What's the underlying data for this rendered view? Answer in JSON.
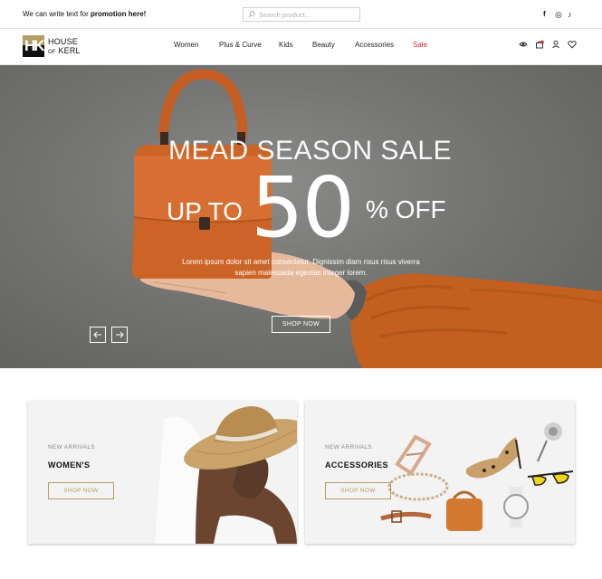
{
  "promo": {
    "prefix": "We can write text for ",
    "bold": "promotion here!"
  },
  "search": {
    "placeholder": "Search product..."
  },
  "social": {
    "facebook": "f",
    "instagram": "◎",
    "tiktok": "♪"
  },
  "logo": {
    "mark": "HK",
    "line1": "HOUSE",
    "line2_small": "OF",
    "line2": "KERL"
  },
  "nav": {
    "items": [
      "Women",
      "Plus & Curve",
      "Kids",
      "Beauty",
      "Accessories",
      "Sale"
    ],
    "icons": [
      "eye-icon",
      "bag-icon",
      "user-icon",
      "heart-icon"
    ]
  },
  "hero": {
    "title": "MEAD SEASON SALE",
    "upto": "UP TO",
    "big": "50",
    "off": "% OFF",
    "subtitle": "Lorem ipsum dolor sit amet consectetur. Dignissim diam risus risus viverra sapien malesuada egestas integer lorem.",
    "button": "SHOP NOW",
    "colors": {
      "bag": "#d0662a",
      "sweater": "#c8611f"
    }
  },
  "cards": [
    {
      "kicker": "NEW ARRIVALS",
      "title": "WOMEN'S",
      "button": "SHOP NOW"
    },
    {
      "kicker": "NEW ARRIVALS",
      "title": "ACCESSORIES",
      "button": "SHOP NOW"
    }
  ],
  "colors": {
    "accent_gold": "#b49d62",
    "sale_red": "#e0242b"
  }
}
